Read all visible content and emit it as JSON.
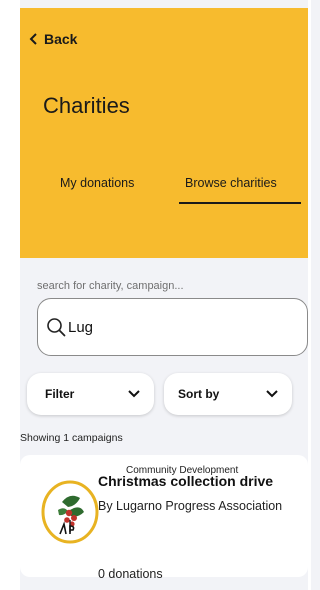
{
  "header": {
    "back_label": "Back",
    "title": "Charities",
    "tabs": [
      {
        "label": "My donations",
        "active": false
      },
      {
        "label": "Browse charities",
        "active": true
      }
    ],
    "background_color": "#f7bb2e"
  },
  "search": {
    "hint": "search for charity, campaign...",
    "value": "Lug",
    "icon": "search-icon"
  },
  "controls": {
    "filter_label": "Filter",
    "sort_label": "Sort by"
  },
  "results": {
    "summary": "Showing 1 campaigns",
    "campaigns": [
      {
        "category": "Community Development",
        "title": "Christmas collection drive",
        "organization": "By Lugarno Progress Association",
        "donations": "0 donations",
        "logo_icon": "lugarno-progress-logo"
      }
    ]
  }
}
